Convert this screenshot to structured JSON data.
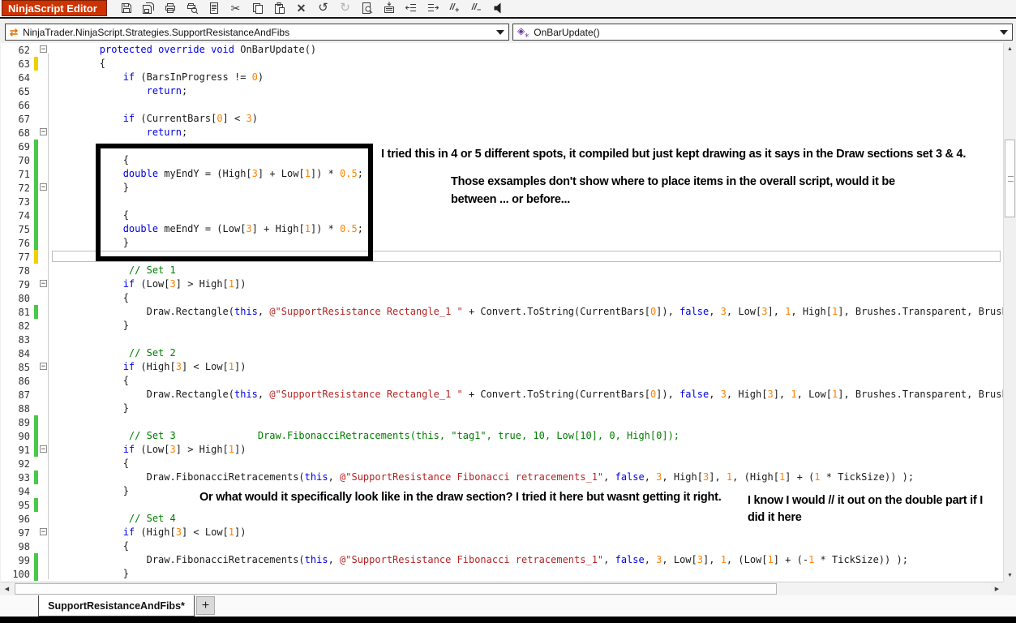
{
  "window": {
    "title": "NinjaScript Editor"
  },
  "toolbar": {
    "icons": [
      {
        "name": "save-icon",
        "enabled": true
      },
      {
        "name": "save-all-icon",
        "enabled": true
      },
      {
        "name": "print-icon",
        "enabled": true
      },
      {
        "name": "print-preview-icon",
        "enabled": true
      },
      {
        "name": "page-setup-icon",
        "enabled": true
      },
      {
        "name": "cut-icon",
        "enabled": true
      },
      {
        "name": "copy-icon",
        "enabled": true
      },
      {
        "name": "paste-icon",
        "enabled": true
      },
      {
        "name": "delete-icon",
        "enabled": true
      },
      {
        "name": "undo-icon",
        "enabled": true
      },
      {
        "name": "redo-icon",
        "enabled": false
      },
      {
        "name": "find-icon",
        "enabled": true
      },
      {
        "name": "compile-icon",
        "enabled": true
      },
      {
        "name": "outdent-icon",
        "enabled": true
      },
      {
        "name": "indent-icon",
        "enabled": true
      },
      {
        "name": "comment-icon",
        "enabled": true
      },
      {
        "name": "uncomment-icon",
        "enabled": true
      },
      {
        "name": "mute-icon",
        "enabled": true
      }
    ]
  },
  "nav": {
    "class_selector": "NinjaTrader.NinjaScript.Strategies.SupportResistanceAndFibs",
    "method_selector": "OnBarUpdate()"
  },
  "editor": {
    "lines": [
      {
        "n": 62,
        "f": true,
        "s": [
          [
            "p",
            "        "
          ],
          [
            "k",
            "protected"
          ],
          [
            "p",
            " "
          ],
          [
            "k",
            "override"
          ],
          [
            "p",
            " "
          ],
          [
            "k",
            "void"
          ],
          [
            "p",
            " OnBarUpdate()"
          ]
        ]
      },
      {
        "n": 63,
        "b": "y",
        "s": [
          [
            "p",
            "        {"
          ]
        ]
      },
      {
        "n": 64,
        "s": [
          [
            "p",
            "            "
          ],
          [
            "k",
            "if"
          ],
          [
            "p",
            " (BarsInProgress != "
          ],
          [
            "n",
            "0"
          ],
          [
            "p",
            ")"
          ]
        ]
      },
      {
        "n": 65,
        "s": [
          [
            "p",
            "                "
          ],
          [
            "k",
            "return"
          ],
          [
            "p",
            ";"
          ]
        ]
      },
      {
        "n": 66,
        "s": []
      },
      {
        "n": 67,
        "s": [
          [
            "p",
            "            "
          ],
          [
            "k",
            "if"
          ],
          [
            "p",
            " (CurrentBars["
          ],
          [
            "n",
            "0"
          ],
          [
            "p",
            "] < "
          ],
          [
            "n",
            "3"
          ],
          [
            "p",
            ")"
          ]
        ]
      },
      {
        "n": 68,
        "f": true,
        "s": [
          [
            "p",
            "                "
          ],
          [
            "k",
            "return"
          ],
          [
            "p",
            ";"
          ]
        ]
      },
      {
        "n": 69,
        "b": "g",
        "s": []
      },
      {
        "n": 70,
        "b": "g",
        "s": [
          [
            "p",
            "            {"
          ]
        ]
      },
      {
        "n": 71,
        "b": "g",
        "s": [
          [
            "p",
            "            "
          ],
          [
            "k",
            "double"
          ],
          [
            "p",
            " myEndY = (High["
          ],
          [
            "n",
            "3"
          ],
          [
            "p",
            "] + Low["
          ],
          [
            "n",
            "1"
          ],
          [
            "p",
            "]) * "
          ],
          [
            "n",
            "0.5"
          ],
          [
            "p",
            ";"
          ]
        ]
      },
      {
        "n": 72,
        "b": "g",
        "f": true,
        "s": [
          [
            "p",
            "            }"
          ]
        ]
      },
      {
        "n": 73,
        "b": "g",
        "s": []
      },
      {
        "n": 74,
        "b": "g",
        "s": [
          [
            "p",
            "            {"
          ]
        ]
      },
      {
        "n": 75,
        "b": "g",
        "s": [
          [
            "p",
            "            "
          ],
          [
            "k",
            "double"
          ],
          [
            "p",
            " meEndY = (Low["
          ],
          [
            "n",
            "3"
          ],
          [
            "p",
            "] + High["
          ],
          [
            "n",
            "1"
          ],
          [
            "p",
            "]) * "
          ],
          [
            "n",
            "0.5"
          ],
          [
            "p",
            ";"
          ]
        ]
      },
      {
        "n": 76,
        "b": "g",
        "s": [
          [
            "p",
            "            }"
          ]
        ]
      },
      {
        "n": 77,
        "b": "y",
        "s": []
      },
      {
        "n": 78,
        "s": [
          [
            "c",
            "             // Set 1"
          ]
        ]
      },
      {
        "n": 79,
        "f": true,
        "s": [
          [
            "p",
            "            "
          ],
          [
            "k",
            "if"
          ],
          [
            "p",
            " (Low["
          ],
          [
            "n",
            "3"
          ],
          [
            "p",
            "] > High["
          ],
          [
            "n",
            "1"
          ],
          [
            "p",
            "])"
          ]
        ]
      },
      {
        "n": 80,
        "s": [
          [
            "p",
            "            {"
          ]
        ]
      },
      {
        "n": 81,
        "b": "g",
        "s": [
          [
            "p",
            "                Draw.Rectangle("
          ],
          [
            "k",
            "this"
          ],
          [
            "p",
            ", "
          ],
          [
            "s",
            "@\"SupportResistance Rectangle_1 \""
          ],
          [
            "p",
            " + Convert.ToString(CurrentBars["
          ],
          [
            "n",
            "0"
          ],
          [
            "p",
            "]), "
          ],
          [
            "k",
            "false"
          ],
          [
            "p",
            ", "
          ],
          [
            "n",
            "3"
          ],
          [
            "p",
            ", Low["
          ],
          [
            "n",
            "3"
          ],
          [
            "p",
            "], "
          ],
          [
            "n",
            "1"
          ],
          [
            "p",
            ", High["
          ],
          [
            "n",
            "1"
          ],
          [
            "p",
            "], Brushes.Transparent, Brushes.D"
          ]
        ]
      },
      {
        "n": 82,
        "s": [
          [
            "p",
            "            }"
          ]
        ]
      },
      {
        "n": 83,
        "s": []
      },
      {
        "n": 84,
        "s": [
          [
            "c",
            "             // Set 2"
          ]
        ]
      },
      {
        "n": 85,
        "f": true,
        "s": [
          [
            "p",
            "            "
          ],
          [
            "k",
            "if"
          ],
          [
            "p",
            " (High["
          ],
          [
            "n",
            "3"
          ],
          [
            "p",
            "] < Low["
          ],
          [
            "n",
            "1"
          ],
          [
            "p",
            "])"
          ]
        ]
      },
      {
        "n": 86,
        "s": [
          [
            "p",
            "            {"
          ]
        ]
      },
      {
        "n": 87,
        "s": [
          [
            "p",
            "                Draw.Rectangle("
          ],
          [
            "k",
            "this"
          ],
          [
            "p",
            ", "
          ],
          [
            "s",
            "@\"SupportResistance Rectangle_1 \""
          ],
          [
            "p",
            " + Convert.ToString(CurrentBars["
          ],
          [
            "n",
            "0"
          ],
          [
            "p",
            "]), "
          ],
          [
            "k",
            "false"
          ],
          [
            "p",
            ", "
          ],
          [
            "n",
            "3"
          ],
          [
            "p",
            ", High["
          ],
          [
            "n",
            "3"
          ],
          [
            "p",
            "], "
          ],
          [
            "n",
            "1"
          ],
          [
            "p",
            ", Low["
          ],
          [
            "n",
            "1"
          ],
          [
            "p",
            "], Brushes.Transparent, Brushes.L"
          ]
        ]
      },
      {
        "n": 88,
        "s": [
          [
            "p",
            "            }"
          ]
        ]
      },
      {
        "n": 89,
        "b": "g",
        "s": []
      },
      {
        "n": 90,
        "b": "g",
        "s": [
          [
            "c",
            "             // Set 3              Draw.FibonacciRetracements(this, \"tag1\", true, 10, Low[10], 0, High[0]);"
          ]
        ]
      },
      {
        "n": 91,
        "b": "g",
        "f": true,
        "s": [
          [
            "p",
            "            "
          ],
          [
            "k",
            "if"
          ],
          [
            "p",
            " (Low["
          ],
          [
            "n",
            "3"
          ],
          [
            "p",
            "] > High["
          ],
          [
            "n",
            "1"
          ],
          [
            "p",
            "])"
          ]
        ]
      },
      {
        "n": 92,
        "s": [
          [
            "p",
            "            {"
          ]
        ]
      },
      {
        "n": 93,
        "b": "g",
        "s": [
          [
            "p",
            "                Draw.FibonacciRetracements("
          ],
          [
            "k",
            "this"
          ],
          [
            "p",
            ", "
          ],
          [
            "s",
            "@\"SupportResistance Fibonacci retracements_1\""
          ],
          [
            "p",
            ", "
          ],
          [
            "k",
            "false"
          ],
          [
            "p",
            ", "
          ],
          [
            "n",
            "3"
          ],
          [
            "p",
            ", High["
          ],
          [
            "n",
            "3"
          ],
          [
            "p",
            "], "
          ],
          [
            "n",
            "1"
          ],
          [
            "p",
            ", (High["
          ],
          [
            "n",
            "1"
          ],
          [
            "p",
            "] + ("
          ],
          [
            "n",
            "1"
          ],
          [
            "p",
            " * TickSize)) );"
          ]
        ]
      },
      {
        "n": 94,
        "s": [
          [
            "p",
            "            }"
          ]
        ]
      },
      {
        "n": 95,
        "b": "g",
        "s": []
      },
      {
        "n": 96,
        "s": [
          [
            "c",
            "             // Set 4"
          ]
        ]
      },
      {
        "n": 97,
        "f": true,
        "s": [
          [
            "p",
            "            "
          ],
          [
            "k",
            "if"
          ],
          [
            "p",
            " (High["
          ],
          [
            "n",
            "3"
          ],
          [
            "p",
            "] < Low["
          ],
          [
            "n",
            "1"
          ],
          [
            "p",
            "])"
          ]
        ]
      },
      {
        "n": 98,
        "s": [
          [
            "p",
            "            {"
          ]
        ]
      },
      {
        "n": 99,
        "b": "g",
        "s": [
          [
            "p",
            "                Draw.FibonacciRetracements("
          ],
          [
            "k",
            "this"
          ],
          [
            "p",
            ", "
          ],
          [
            "s",
            "@\"SupportResistance Fibonacci retracements_1\""
          ],
          [
            "p",
            ", "
          ],
          [
            "k",
            "false"
          ],
          [
            "p",
            ", "
          ],
          [
            "n",
            "3"
          ],
          [
            "p",
            ", Low["
          ],
          [
            "n",
            "3"
          ],
          [
            "p",
            "], "
          ],
          [
            "n",
            "1"
          ],
          [
            "p",
            ", (Low["
          ],
          [
            "n",
            "1"
          ],
          [
            "p",
            "] + (-"
          ],
          [
            "n",
            "1"
          ],
          [
            "p",
            " * TickSize)) );"
          ]
        ]
      },
      {
        "n": 100,
        "b": "g",
        "s": [
          [
            "p",
            "            }"
          ]
        ]
      }
    ]
  },
  "annotations": {
    "note1": "I tried this in 4 or 5 different spots, it compiled but just kept drawing as it says in the Draw sections set 3 & 4.",
    "note2": "Those exsamples don't show where to place items in the overall script, would it be\nbetween ... or before...",
    "note3": "Or what would it specifically look like in the draw section? I tried it here but wasnt getting it right.",
    "note4": "I know I would // it out on the double part if I\ndid it here"
  },
  "tabs": {
    "active": "SupportResistanceAndFibs*",
    "new_tab": "+"
  },
  "scrollbar": {
    "up": "▲",
    "down": "▼",
    "left": "◀",
    "right": "▶"
  },
  "colors": {
    "accent": "#cc3301",
    "keyword": "#0000e6",
    "number": "#ff8200",
    "string": "#b32424",
    "comment": "#007d00",
    "change_green": "#48c948",
    "change_yellow": "#efcf00"
  }
}
